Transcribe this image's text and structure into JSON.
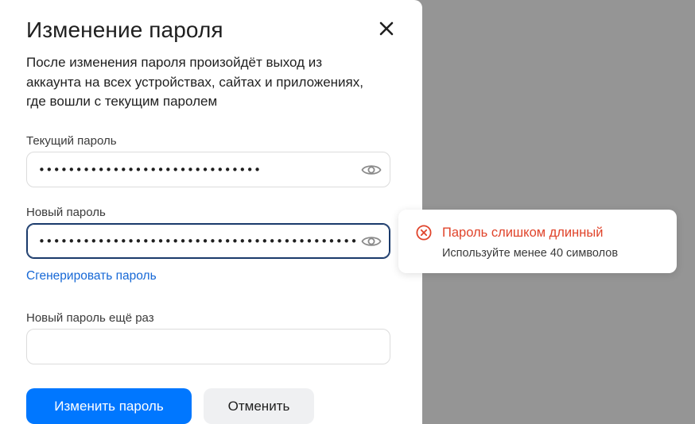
{
  "dialog": {
    "title": "Изменение пароля",
    "description": "После изменения пароля произойдёт выход из аккаунта на всех устройствах, сайтах и приложениях, где вошли с текущим паролем"
  },
  "fields": {
    "current_password": {
      "label": "Текущий пароль",
      "value": "••••••••••••••••••••••••••••••"
    },
    "new_password": {
      "label": "Новый пароль",
      "value": "•••••••••••••••••••••••••••••••••••••••••••••"
    },
    "repeat_password": {
      "label": "Новый пароль ещё раз",
      "value": ""
    }
  },
  "generate_link": "Сгенерировать пароль",
  "buttons": {
    "submit": "Изменить пароль",
    "cancel": "Отменить"
  },
  "error_tooltip": {
    "title": "Пароль слишком длинный",
    "hint": "Используйте менее 40 символов"
  },
  "colors": {
    "primary": "#0077ff",
    "link": "#1668d6",
    "error": "#e0442b",
    "overlay": "#959595",
    "focus_border": "#1a3a6b"
  },
  "icons": {
    "close": "close-icon",
    "show_password": "eye-icon",
    "error": "error-circle-icon"
  }
}
